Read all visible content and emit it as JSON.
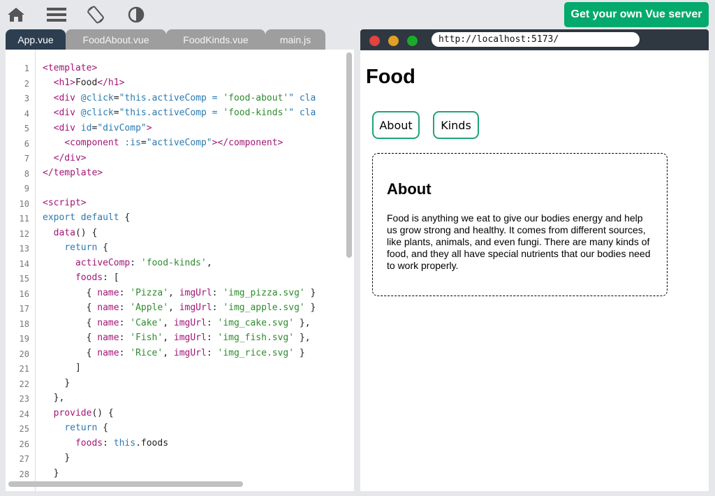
{
  "toolbar": {
    "icons": [
      "home-icon",
      "menu-icon",
      "rotate-icon",
      "contrast-icon"
    ],
    "cta_label": "Get your own Vue server",
    "cta_color": "#04aa6d"
  },
  "tabs": [
    {
      "label": "App.vue",
      "active": true
    },
    {
      "label": "FoodAbout.vue",
      "active": false
    },
    {
      "label": "FoodKinds.vue",
      "active": false
    },
    {
      "label": "main.js",
      "active": false
    }
  ],
  "line_numbers": [
    "1",
    "2",
    "3",
    "4",
    "5",
    "6",
    "7",
    "8",
    "9",
    "10",
    "11",
    "12",
    "13",
    "14",
    "15",
    "16",
    "17",
    "18",
    "19",
    "20",
    "21",
    "22",
    "23",
    "24",
    "25",
    "26",
    "27",
    "28"
  ],
  "code": {
    "l1": [
      "<template>"
    ],
    "l2": [
      "<h1>",
      "Food",
      "</h1>"
    ],
    "l3": [
      "<div ",
      "@click",
      "=",
      "\"this.activeComp = ",
      "'food-about'",
      "\" cla"
    ],
    "l4": [
      "<div ",
      "@click",
      "=",
      "\"this.activeComp = ",
      "'food-kinds'",
      "\" cla"
    ],
    "l5": [
      "<div ",
      "id",
      "=",
      "\"divComp\"",
      ">"
    ],
    "l6": [
      "<component ",
      ":is",
      "=",
      "\"activeComp\"",
      "></component>"
    ],
    "l7": [
      "</div>"
    ],
    "l8": [
      "</template>"
    ],
    "l10": [
      "<script>"
    ],
    "l11": [
      "export default",
      " {"
    ],
    "l12": [
      "data",
      "() {"
    ],
    "l13": [
      "return",
      " {"
    ],
    "l14": [
      "activeComp",
      ": ",
      "'food-kinds'",
      ","
    ],
    "l15": [
      "foods",
      ": ["
    ],
    "l16": [
      "{ ",
      "name",
      ": ",
      "'Pizza'",
      ", ",
      "imgUrl",
      ": ",
      "'img_pizza.svg'",
      " }"
    ],
    "l17": [
      "{ ",
      "name",
      ": ",
      "'Apple'",
      ", ",
      "imgUrl",
      ": ",
      "'img_apple.svg'",
      " }"
    ],
    "l18": [
      "{ ",
      "name",
      ": ",
      "'Cake'",
      ", ",
      "imgUrl",
      ": ",
      "'img_cake.svg'",
      " },"
    ],
    "l19": [
      "{ ",
      "name",
      ": ",
      "'Fish'",
      ", ",
      "imgUrl",
      ": ",
      "'img_fish.svg'",
      " },"
    ],
    "l20": [
      "{ ",
      "name",
      ": ",
      "'Rice'",
      ", ",
      "imgUrl",
      ": ",
      "'img_rice.svg'",
      " }"
    ],
    "l21": [
      "]"
    ],
    "l22": [
      "}"
    ],
    "l23": [
      "},"
    ],
    "l24": [
      "provide",
      "() {"
    ],
    "l25": [
      "return",
      " {"
    ],
    "l26": [
      "foods",
      ": ",
      "this",
      ".foods"
    ],
    "l27": [
      "}"
    ],
    "l28": [
      "}"
    ]
  },
  "browser": {
    "url": "http://localhost:5173/",
    "title": "Food",
    "buttons": [
      "About",
      "Kinds"
    ],
    "component_heading": "About",
    "component_text": "Food is anything we eat to give our bodies energy and help us grow strong and healthy. It comes from different sources, like plants, animals, and even fungi. There are many kinds of food, and they all have special nutrients that our bodies need to work properly."
  }
}
